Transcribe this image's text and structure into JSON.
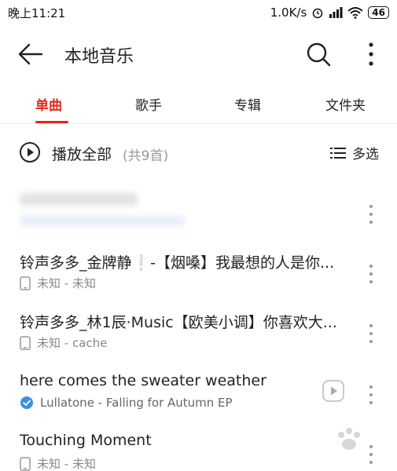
{
  "status_bar": {
    "time": "晚上11:21",
    "net_speed": "1.0K/s",
    "battery": "46"
  },
  "app_bar": {
    "title": "本地音乐"
  },
  "tabs": [
    {
      "label": "单曲",
      "active": true
    },
    {
      "label": "歌手",
      "active": false
    },
    {
      "label": "专辑",
      "active": false
    },
    {
      "label": "文件夹",
      "active": false
    }
  ],
  "play_all": {
    "label": "播放全部",
    "count": "(共9首)",
    "multi_select": "多选"
  },
  "songs": [
    {
      "title": "",
      "subtitle": "",
      "blurred": true
    },
    {
      "title": "铃声多多_金牌静❕-【烟嗓】我最想的人是你...",
      "subtitle": "未知 - 未知",
      "icon": "phone-icon"
    },
    {
      "title": "铃声多多_林1辰·Music【欧美小调】你喜欢大...",
      "subtitle": "未知 - cache",
      "icon": "phone-icon"
    },
    {
      "title": "here comes the sweater weather",
      "subtitle": "Lullatone - Falling for Autumn  EP",
      "icon": "check-circle-icon",
      "has_play_button": true
    },
    {
      "title": "Touching Moment",
      "subtitle": "未知 - 未知",
      "icon": "phone-icon"
    }
  ],
  "colors": {
    "accent": "#e0271c",
    "check_blue": "#3d8fe0"
  }
}
